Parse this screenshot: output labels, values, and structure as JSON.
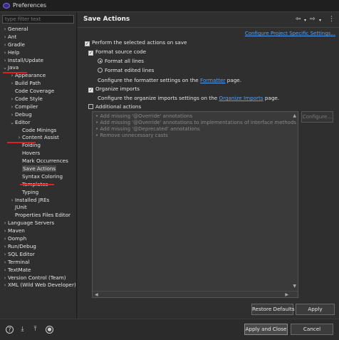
{
  "window": {
    "title": "Preferences"
  },
  "filter": {
    "placeholder": "type filter text"
  },
  "tree": [
    {
      "label": "General",
      "indent": 0,
      "chevron": "›",
      "name": "tree-item-general"
    },
    {
      "label": "Ant",
      "indent": 0,
      "chevron": "›",
      "name": "tree-item-ant"
    },
    {
      "label": "Gradle",
      "indent": 0,
      "chevron": "›",
      "name": "tree-item-gradle"
    },
    {
      "label": "Help",
      "indent": 0,
      "chevron": "›",
      "name": "tree-item-help"
    },
    {
      "label": "Install/Update",
      "indent": 0,
      "chevron": "›",
      "name": "tree-item-install-update"
    },
    {
      "label": "Java",
      "indent": 0,
      "chevron": "⌄",
      "name": "tree-item-java"
    },
    {
      "label": "Appearance",
      "indent": 1,
      "chevron": "›",
      "name": "tree-item-appearance"
    },
    {
      "label": "Build Path",
      "indent": 1,
      "chevron": "›",
      "name": "tree-item-build-path"
    },
    {
      "label": "Code Coverage",
      "indent": 1,
      "chevron": "",
      "name": "tree-item-code-coverage"
    },
    {
      "label": "Code Style",
      "indent": 1,
      "chevron": "›",
      "name": "tree-item-code-style"
    },
    {
      "label": "Compiler",
      "indent": 1,
      "chevron": "›",
      "name": "tree-item-compiler"
    },
    {
      "label": "Debug",
      "indent": 1,
      "chevron": "›",
      "name": "tree-item-debug"
    },
    {
      "label": "Editor",
      "indent": 1,
      "chevron": "⌄",
      "name": "tree-item-editor"
    },
    {
      "label": "Code Minings",
      "indent": 2,
      "chevron": "",
      "name": "tree-item-code-minings"
    },
    {
      "label": "Content Assist",
      "indent": 2,
      "chevron": "›",
      "name": "tree-item-content-assist"
    },
    {
      "label": "Folding",
      "indent": 2,
      "chevron": "",
      "name": "tree-item-folding"
    },
    {
      "label": "Hovers",
      "indent": 2,
      "chevron": "",
      "name": "tree-item-hovers"
    },
    {
      "label": "Mark Occurrences",
      "indent": 2,
      "chevron": "",
      "name": "tree-item-mark-occurrences"
    },
    {
      "label": "Save Actions",
      "indent": 2,
      "chevron": "",
      "name": "tree-item-save-actions",
      "selected": true
    },
    {
      "label": "Syntax Coloring",
      "indent": 2,
      "chevron": "",
      "name": "tree-item-syntax-coloring"
    },
    {
      "label": "Templates",
      "indent": 2,
      "chevron": "",
      "name": "tree-item-templates"
    },
    {
      "label": "Typing",
      "indent": 2,
      "chevron": "",
      "name": "tree-item-typing"
    },
    {
      "label": "Installed JREs",
      "indent": 1,
      "chevron": "›",
      "name": "tree-item-installed-jres"
    },
    {
      "label": "JUnit",
      "indent": 1,
      "chevron": "",
      "name": "tree-item-junit"
    },
    {
      "label": "Properties Files Editor",
      "indent": 1,
      "chevron": "",
      "name": "tree-item-properties-files-editor"
    },
    {
      "label": "Language Servers",
      "indent": 0,
      "chevron": "›",
      "name": "tree-item-language-servers"
    },
    {
      "label": "Maven",
      "indent": 0,
      "chevron": "›",
      "name": "tree-item-maven"
    },
    {
      "label": "Oomph",
      "indent": 0,
      "chevron": "›",
      "name": "tree-item-oomph"
    },
    {
      "label": "Run/Debug",
      "indent": 0,
      "chevron": "›",
      "name": "tree-item-run-debug"
    },
    {
      "label": "SQL Editor",
      "indent": 0,
      "chevron": "›",
      "name": "tree-item-sql-editor"
    },
    {
      "label": "Terminal",
      "indent": 0,
      "chevron": "›",
      "name": "tree-item-terminal"
    },
    {
      "label": "TextMate",
      "indent": 0,
      "chevron": "›",
      "name": "tree-item-textmate"
    },
    {
      "label": "Version Control (Team)",
      "indent": 0,
      "chevron": "›",
      "name": "tree-item-version-control"
    },
    {
      "label": "XML (Wild Web Developer)",
      "indent": 0,
      "chevron": "›",
      "name": "tree-item-xml"
    }
  ],
  "page": {
    "title": "Save Actions",
    "configure_project_link": "Configure Project Specific Settings...",
    "perform_label": "Perform the selected actions on save",
    "format_source_label": "Format source code",
    "format_all_label": "Format all lines",
    "format_edited_label": "Format edited lines",
    "formatter_text": "Configure the formatter settings on the",
    "formatter_link": "Formatter",
    "page_suffix": "page.",
    "organize_imports_label": "Organize imports",
    "organize_text": "Configure the organize imports settings on the",
    "organize_link": "Organize Imports",
    "additional_label": "Additional actions",
    "additional_items": [
      "Add missing '@Override' annotations",
      "Add missing '@Override' annotations to implementations of interface methods",
      "Add missing '@Deprecated' annotations",
      "Remove unnecessary casts"
    ],
    "configure_button": "Configure...",
    "restore_defaults": "Restore Defaults",
    "apply": "Apply"
  },
  "footer": {
    "apply_close": "Apply and Close",
    "cancel": "Cancel"
  },
  "state": {
    "perform_checked": true,
    "format_source_checked": true,
    "format_mode": "all",
    "organize_imports_checked": true,
    "additional_checked": false
  }
}
